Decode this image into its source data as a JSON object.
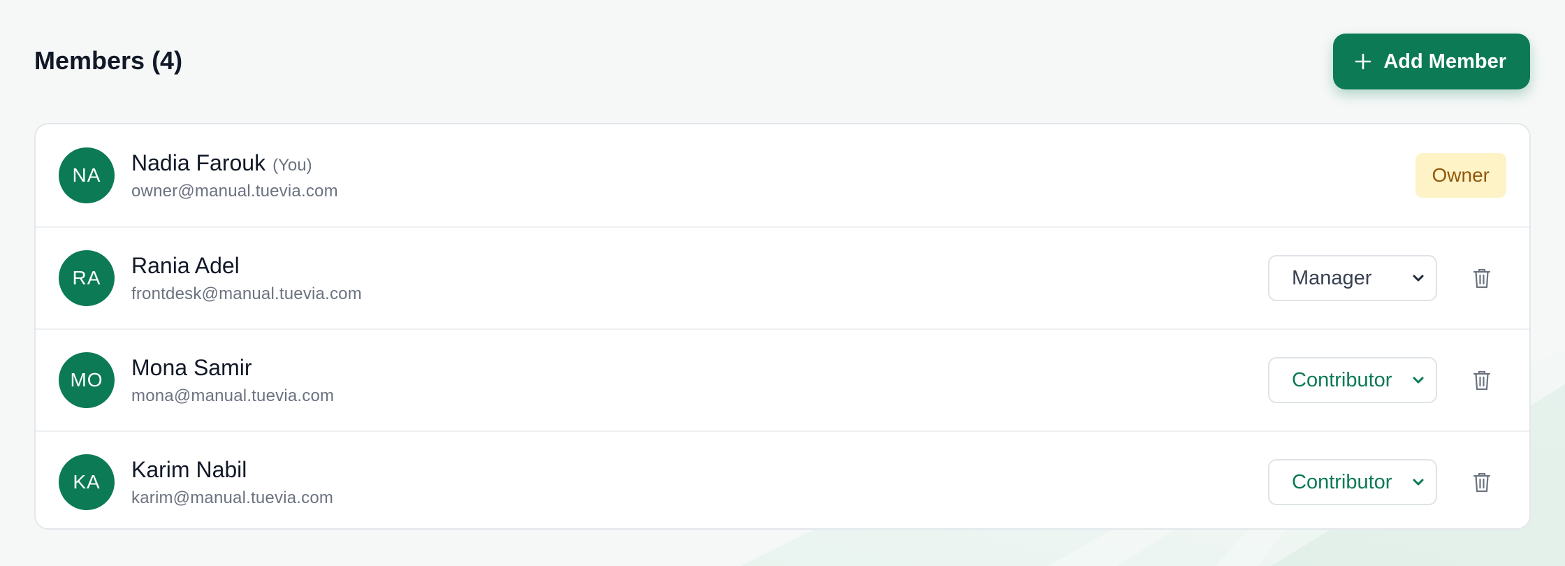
{
  "header": {
    "title": "Members (4)",
    "add_label": "Add Member"
  },
  "members": [
    {
      "initials": "NA",
      "name": "Nadia Farouk",
      "you": "(You)",
      "email": "owner@manual.tuevia.com",
      "badge": "Owner"
    },
    {
      "initials": "RA",
      "name": "Rania Adel",
      "email": "frontdesk@manual.tuevia.com",
      "role": "Manager"
    },
    {
      "initials": "MO",
      "name": "Mona Samir",
      "email": "mona@manual.tuevia.com",
      "role": "Contributor"
    },
    {
      "initials": "KA",
      "name": "Karim Nabil",
      "email": "karim@manual.tuevia.com",
      "role": "Contributor"
    }
  ],
  "colors": {
    "accent": "#0b7a55",
    "owner_badge_bg": "#fef3c7",
    "owner_badge_text": "#92580c"
  },
  "icons": {
    "add": "plus-icon",
    "select": "chevron-down-icon",
    "remove": "trash-icon"
  }
}
